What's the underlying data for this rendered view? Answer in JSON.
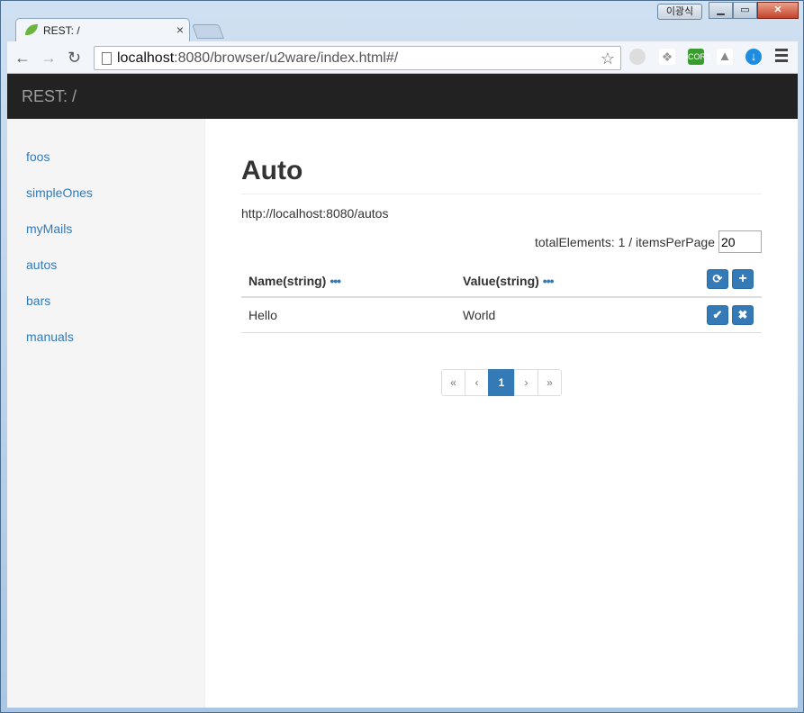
{
  "browser": {
    "tab_title": "REST: /",
    "tab_close": "×",
    "user_label": "이광식",
    "url_host": "localhost",
    "url_rest": ":8080/browser/u2ware/index.html#/",
    "cors_label": "CORS"
  },
  "app": {
    "brand": "REST: /",
    "sidebar": [
      {
        "label": "foos"
      },
      {
        "label": "simpleOnes"
      },
      {
        "label": "myMails"
      },
      {
        "label": "autos"
      },
      {
        "label": "bars"
      },
      {
        "label": "manuals"
      }
    ],
    "page_title": "Auto",
    "api_url": "http://localhost:8080/autos",
    "total_elements_label": "totalElements: 1 /  itemsPerPage",
    "items_per_page": "20",
    "columns": [
      {
        "label": "Name(string)",
        "menu": "•••"
      },
      {
        "label": "Value(string)",
        "menu": "•••"
      }
    ],
    "rows": [
      {
        "name": "Hello",
        "value": "World"
      }
    ],
    "pagination": {
      "first": "«",
      "prev": "‹",
      "current": "1",
      "next": "›",
      "last": "»"
    }
  },
  "colors": {
    "primary": "#337ab7",
    "navbar": "#222222",
    "sidebar": "#f5f5f5"
  }
}
